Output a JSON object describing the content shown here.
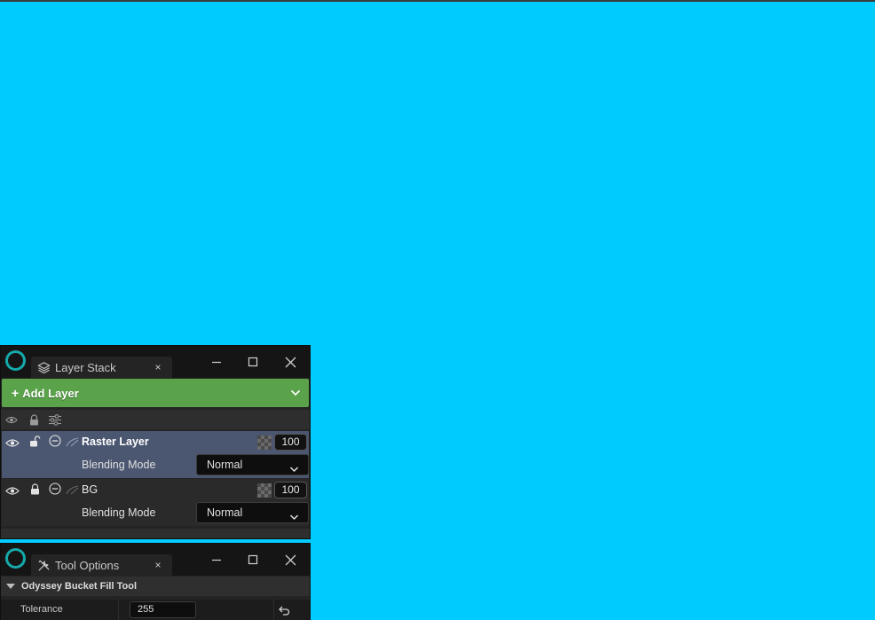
{
  "colors": {
    "canvas": "#00CBFF",
    "panel": "#242424",
    "accent_green": "#5BA34B",
    "selected_row": "#4B5670",
    "logo": "#16A9A9"
  },
  "layer_stack": {
    "tab_title": "Layer Stack",
    "tab_icon": "layers-icon",
    "tab_close": "×",
    "add_layer_label": "Add Layer",
    "add_layer_icon": "plus-icon",
    "header_icons": [
      "eye-icon",
      "lock-icon",
      "sliders-icon"
    ],
    "layers": [
      {
        "name": "Raster Layer",
        "selected": true,
        "opacity": "100",
        "blending_label": "Blending Mode",
        "blending_value": "Normal"
      },
      {
        "name": "BG",
        "selected": false,
        "opacity": "100",
        "blending_label": "Blending Mode",
        "blending_value": "Normal"
      }
    ]
  },
  "tool_options": {
    "tab_title": "Tool Options",
    "tab_icon": "tools-icon",
    "tab_close": "×",
    "section_title": "Odyssey Bucket Fill Tool",
    "properties": [
      {
        "label": "Tolerance",
        "value": "255"
      }
    ]
  }
}
